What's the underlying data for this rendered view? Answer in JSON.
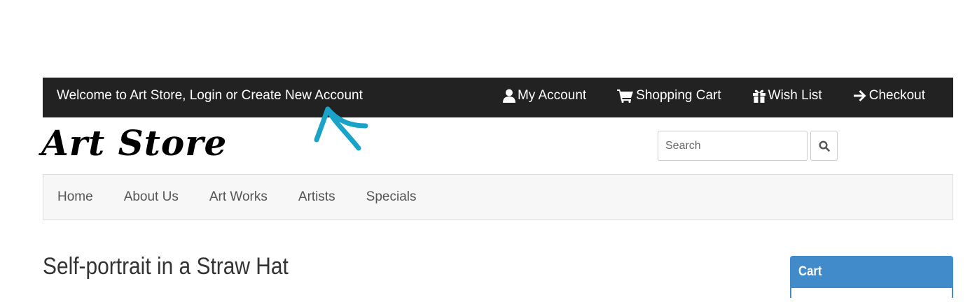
{
  "topbar": {
    "welcome_text": "Welcome to Art Store, Login or Create New Account",
    "links": [
      {
        "label": "My Account",
        "icon": "user-icon"
      },
      {
        "label": "Shopping Cart",
        "icon": "cart-icon"
      },
      {
        "label": "Wish List",
        "icon": "gift-icon"
      },
      {
        "label": "Checkout",
        "icon": "arrow-right-icon"
      }
    ]
  },
  "logo": {
    "text": "Art Store"
  },
  "search": {
    "placeholder": "Search",
    "button_icon": "search-icon"
  },
  "nav": {
    "items": [
      "Home",
      "About Us",
      "Art Works",
      "Artists",
      "Specials"
    ]
  },
  "page": {
    "title": "Self-portrait in a Straw Hat"
  },
  "sidebar": {
    "cart_heading": "Cart"
  },
  "colors": {
    "topbar_bg": "#222222",
    "accent": "#428bca",
    "annotation": "#1aa3c9"
  }
}
